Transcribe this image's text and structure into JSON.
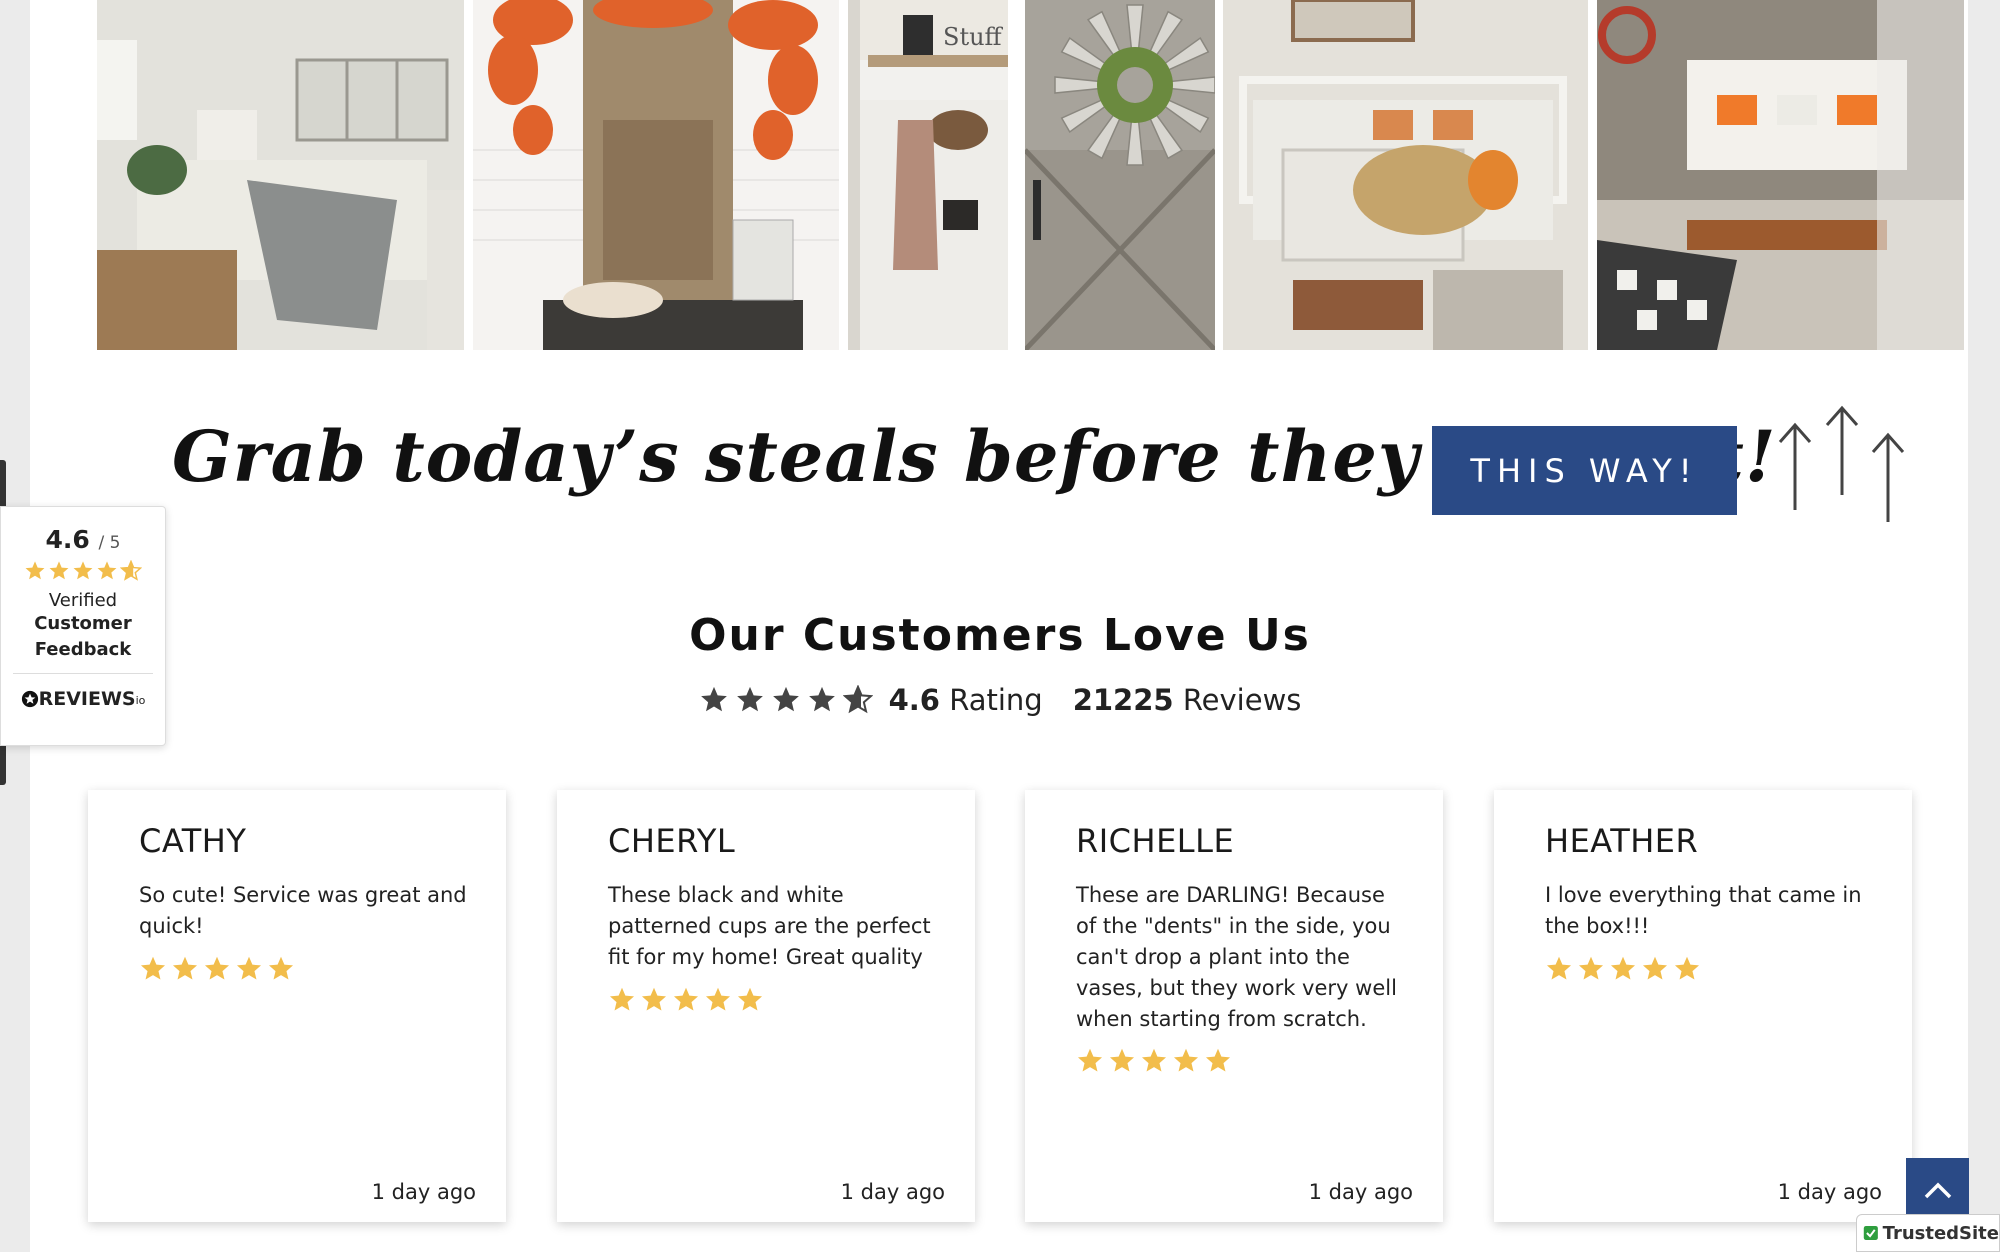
{
  "gallery": {
    "tiles": [
      "bedroom",
      "kitchen-wreath",
      "entryway-hooks",
      "windmill-door",
      "bedroom-basket",
      "entry-bench"
    ],
    "sign_text": "Stuff",
    "next_icon": "chevron-right-icon"
  },
  "banner": {
    "headline": "Grab today’s steals before they run out!",
    "cta": "THIS WAY!"
  },
  "reviews_section": {
    "title": "Our Customers Love Us",
    "rating": "4.6",
    "rating_label": "Rating",
    "count": "21225",
    "count_label": "Reviews",
    "average_stars": 4.6
  },
  "reviews": [
    {
      "name": "CATHY",
      "text": "So cute! Service was great and quick!",
      "stars": 5,
      "date": "1 day ago"
    },
    {
      "name": "CHERYL",
      "text": "These black and white patterned cups are the perfect fit for my home! Great quality",
      "stars": 5,
      "date": "1 day ago"
    },
    {
      "name": "RICHELLE",
      "text": "These are DARLING! Because of the \"dents\" in the side, you can't drop a plant into the vases, but they work very well when starting from scratch.",
      "stars": 5,
      "date": "1 day ago"
    },
    {
      "name": "HEATHER",
      "text": "I love everything that came in the box!!!",
      "stars": 5,
      "date": "1 day ago"
    }
  ],
  "badge": {
    "score": "4.6",
    "out_of": "/ 5",
    "line1": "Verified",
    "line2": "Customer",
    "line3": "Feedback",
    "brand": "REVIEWS",
    "brand_suffix": "io"
  },
  "trusted": "TrustedSite",
  "colors": {
    "accent": "#2a4a86",
    "star": "#f2bd4b",
    "dark_star": "#444444"
  }
}
